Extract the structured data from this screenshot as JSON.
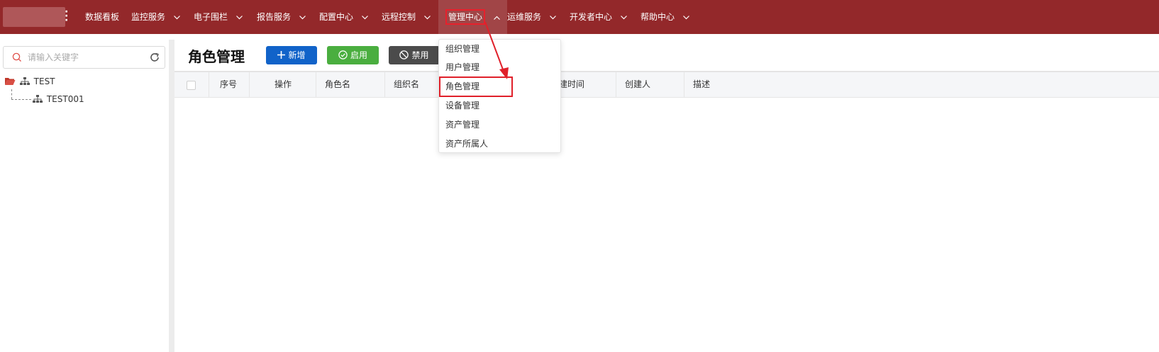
{
  "nav": {
    "items": [
      {
        "label": "数据看板"
      },
      {
        "label": "监控服务"
      },
      {
        "label": "电子围栏"
      },
      {
        "label": "报告服务"
      },
      {
        "label": "配置中心"
      },
      {
        "label": "远程控制"
      },
      {
        "label": "管理中心"
      },
      {
        "label": "运维服务"
      },
      {
        "label": "开发者中心"
      },
      {
        "label": "帮助中心"
      }
    ],
    "active": "管理中心",
    "colors": {
      "bar": "#93282a",
      "active_bg": "#a14547",
      "highlight": "#e8202c"
    }
  },
  "sidebar": {
    "search_placeholder": "请输入关键字",
    "tree": {
      "root": "TEST",
      "child": "TEST001"
    }
  },
  "main": {
    "title": "角色管理",
    "buttons": {
      "add": "新增",
      "enable": "启用",
      "disable": "禁用"
    },
    "table": {
      "columns": [
        "序号",
        "操作",
        "角色名",
        "组织名",
        "创建时间",
        "创建人",
        "描述"
      ],
      "partial_column_text": "建时间"
    }
  },
  "dropdown": {
    "items": [
      "组织管理",
      "用户管理",
      "角色管理",
      "设备管理",
      "资产管理",
      "资产所属人"
    ],
    "highlighted": "角色管理"
  },
  "colors": {
    "add_button": "#1163c9",
    "enable_button": "#4aae3f",
    "disable_button": "#4b4b4b"
  }
}
